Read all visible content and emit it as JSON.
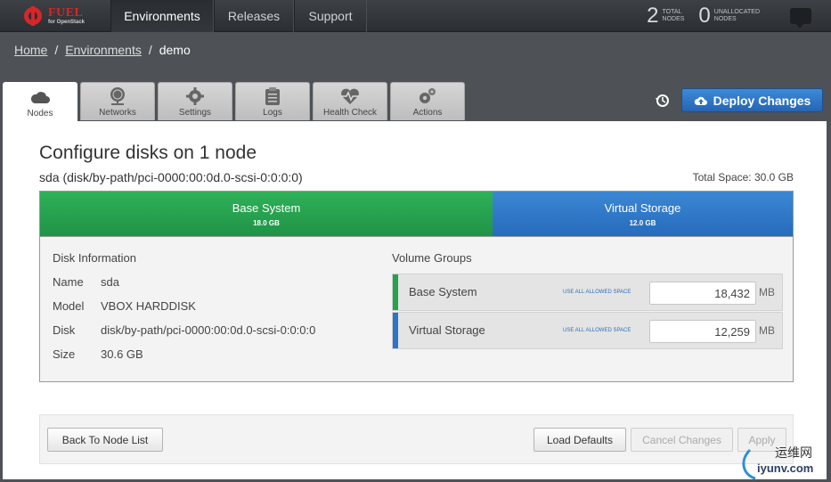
{
  "logo": {
    "line1": "FUEL",
    "line2": "for OpenStack"
  },
  "nav": [
    {
      "label": "Environments"
    },
    {
      "label": "Releases"
    },
    {
      "label": "Support"
    }
  ],
  "stats": {
    "total_nodes": "2",
    "total_label_1": "TOTAL",
    "total_label_2": "NODES",
    "unallocated_nodes": "0",
    "unallocated_label_1": "UNALLOCATED",
    "unallocated_label_2": "NODES"
  },
  "breadcrumb": {
    "home": "Home",
    "environments": "Environments",
    "current": "demo",
    "sep": "/"
  },
  "tabs": [
    {
      "label": "Nodes",
      "icon": "cloud-icon"
    },
    {
      "label": "Networks",
      "icon": "network-icon"
    },
    {
      "label": "Settings",
      "icon": "gear-icon"
    },
    {
      "label": "Logs",
      "icon": "clipboard-icon"
    },
    {
      "label": "Health Check",
      "icon": "heart-pulse-icon"
    },
    {
      "label": "Actions",
      "icon": "gears-icon"
    }
  ],
  "deploy_label": "Deploy Changes",
  "page": {
    "title": "Configure disks on 1 node",
    "disk": "sda (disk/by-path/pci-0000:00:0d.0-scsi-0:0:0:0)",
    "total_space": "Total Space: 30.0 GB"
  },
  "bars": {
    "base": {
      "name": "Base System",
      "size": "18.0 GB",
      "fraction": 0.6
    },
    "virtual": {
      "name": "Virtual Storage",
      "size": "12.0 GB",
      "fraction": 0.4
    }
  },
  "disk_info": {
    "heading": "Disk Information",
    "rows": [
      {
        "key": "Name",
        "value": "sda"
      },
      {
        "key": "Model",
        "value": "VBOX HARDDISK"
      },
      {
        "key": "Disk",
        "value": "disk/by-path/pci-0000:00:0d.0-scsi-0:0:0:0"
      },
      {
        "key": "Size",
        "value": "30.6 GB"
      }
    ]
  },
  "volume_groups": {
    "heading": "Volume Groups",
    "use_all_label": "USE ALL ALLOWED SPACE",
    "unit": "MB",
    "items": [
      {
        "name": "Base System",
        "value": "18,432",
        "color": "#26a14e"
      },
      {
        "name": "Virtual Storage",
        "value": "12,259",
        "color": "#2d74c4"
      }
    ]
  },
  "footer": {
    "back": "Back To Node List",
    "load_defaults": "Load Defaults",
    "cancel": "Cancel Changes",
    "apply": "Apply"
  },
  "watermark": {
    "line1": "运维网",
    "line2": "iyunv.com"
  }
}
